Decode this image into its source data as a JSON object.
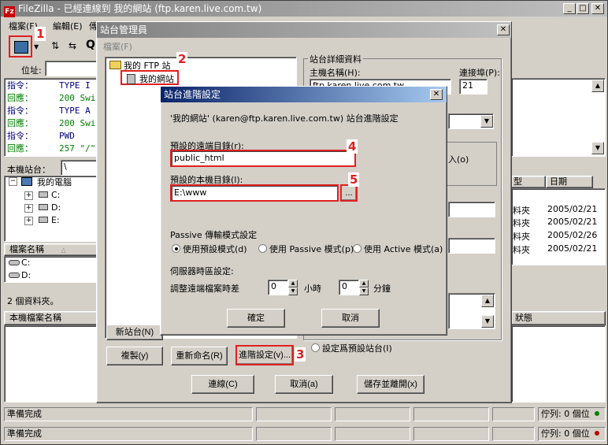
{
  "app": {
    "title": "FileZilla - 已經連線到 我的網站 (ftp.karen.live.com.tw)",
    "menu": [
      "檔案(F)",
      "編輯(E)",
      "傳"
    ],
    "address_label": "位址:",
    "log": [
      {
        "label": "指令：",
        "text": "TYPE I",
        "color": "#000080"
      },
      {
        "label": "回應：",
        "text": "200 Swi",
        "color": "#008000"
      },
      {
        "label": "指令：",
        "text": "TYPE A",
        "color": "#000080"
      },
      {
        "label": "回應：",
        "text": "200 Swi",
        "color": "#008000"
      },
      {
        "label": "指令：",
        "text": "PWD",
        "color": "#000080"
      },
      {
        "label": "回應：",
        "text": "257 \"/\"",
        "color": "#008000"
      }
    ],
    "local_site_label": "本機站台：",
    "local_site_value": "\\",
    "tree": {
      "root": "我的電腦",
      "drives": [
        "C:",
        "D:",
        "E:"
      ]
    },
    "file_header": "檔案名稱",
    "file_rows": [
      "C:",
      "D:"
    ],
    "folder_count": "2 個資料夾。",
    "queue_header": "本機檔案名稱",
    "remote_cols": {
      "type": "型",
      "date": "日期"
    },
    "remote_rows": [
      {
        "type": "料夾",
        "date": "2005/02/21"
      },
      {
        "type": "料夾",
        "date": "2005/02/21"
      },
      {
        "type": "料夾",
        "date": "2005/02/26"
      },
      {
        "type": "料夾",
        "date": "2005/02/21"
      }
    ],
    "state_header": "狀態",
    "status_bar": [
      {
        "text": "準備完成",
        "queue": "佇列: 0 個位"
      },
      {
        "text": "準備完成",
        "queue": "佇列: 0 個位"
      }
    ]
  },
  "site_manager": {
    "title": "站台管理員",
    "sites_label": "檔案(F)",
    "tree_root": "我的 FTP 站",
    "tree_site": "我的網站",
    "details_group": "站台詳細資料",
    "host_label": "主機名稱(H):",
    "host_value": "ftp.karen.live.com.tw",
    "port_label": "連接埠(P):",
    "port_value": "21",
    "anon_fragment": "入(o)",
    "btn_new_site": "新站台(N)",
    "btn_copy": "複製(y)",
    "btn_rename": "重新命名(R)",
    "btn_advanced": "進階設定(v)...",
    "default_site": "設定爲預設站台(I)",
    "btn_connect": "連線(C)",
    "btn_cancel": "取消(a)",
    "btn_save_close": "儲存並離開(x)"
  },
  "advanced": {
    "title": "站台進階設定",
    "heading": "'我的網站' (karen@ftp.karen.live.com.tw) 站台進階設定",
    "remote_dir_label": "預設的遠端目錄(r):",
    "remote_dir_value": "public_html",
    "local_dir_label": "預設的本機目錄(l):",
    "local_dir_value": "E:\\www",
    "browse": "...",
    "passive_label": "Passive 傳輸模式設定",
    "passive_options": [
      "使用預設模式(d)",
      "使用 Passive 模式(p)",
      "使用 Active 模式(a)"
    ],
    "passive_selected": 0,
    "tz_label": "伺服器時區設定:",
    "tz_adjust_label": "調整遠端檔案時差",
    "hours_value": "0",
    "hours_label": "小時",
    "minutes_value": "0",
    "minutes_label": "分鐘",
    "ok": "確定",
    "cancel": "取消"
  },
  "callouts": [
    "1",
    "2",
    "3",
    "4",
    "5"
  ]
}
